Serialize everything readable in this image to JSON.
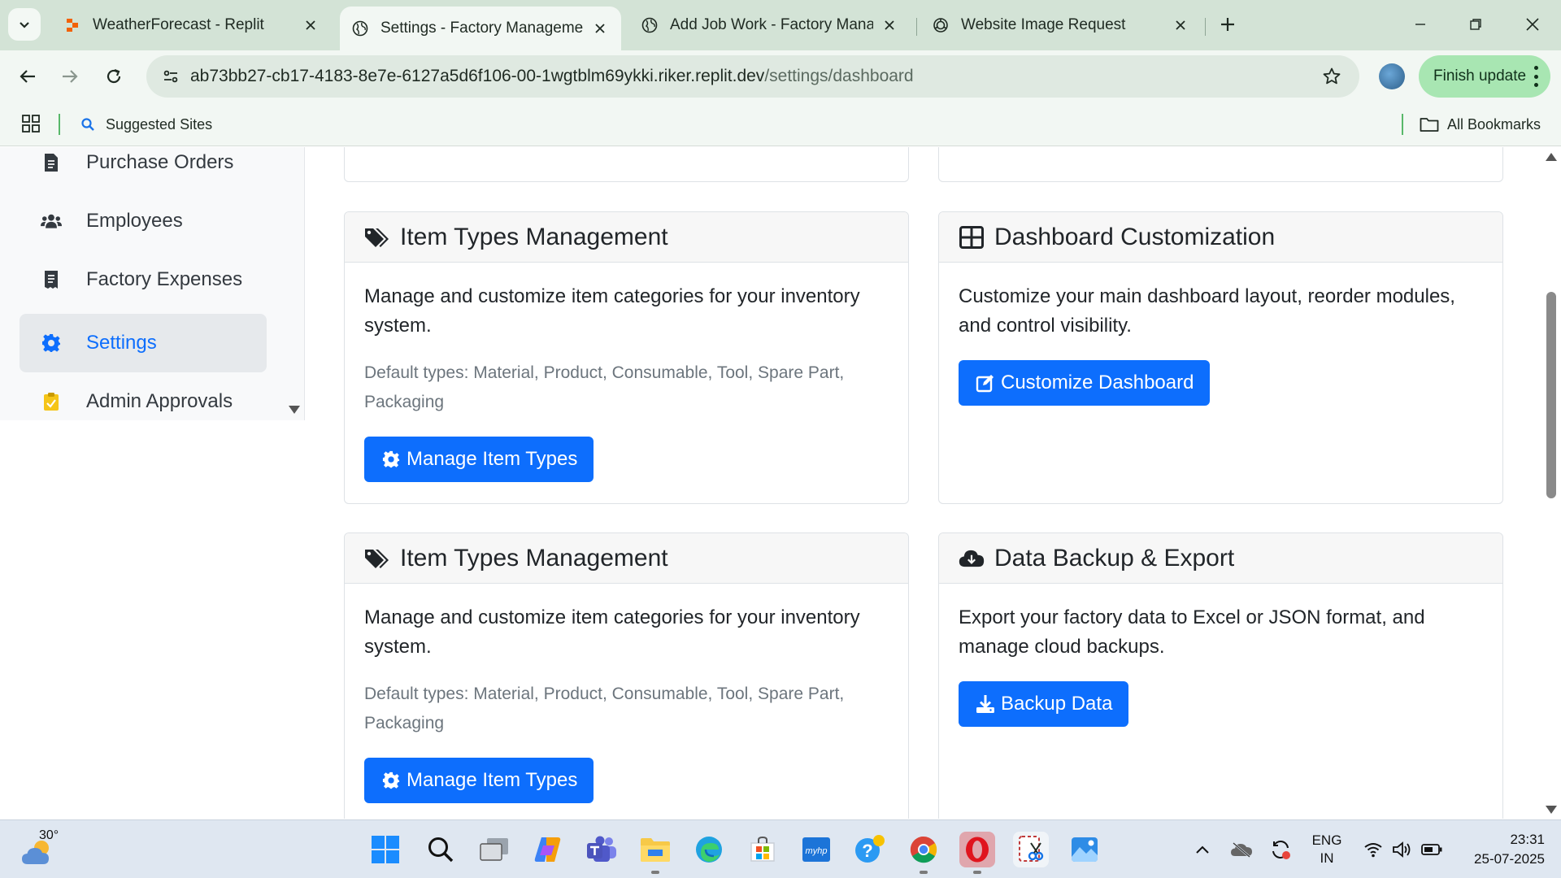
{
  "browser": {
    "tabs": [
      {
        "title": "WeatherForecast - Replit",
        "active": false
      },
      {
        "title": "Settings - Factory Management",
        "active": true
      },
      {
        "title": "Add Job Work - Factory Management",
        "active": false
      },
      {
        "title": "Website Image Request",
        "active": false
      }
    ],
    "url": {
      "host": "ab73bb27-cb17-4183-8e7e-6127a5d6f106-00-1wgtblm69ykki.riker.replit.dev",
      "path": "/settings/dashboard"
    },
    "finish_update_label": "Finish update",
    "bookmarks": {
      "suggested_sites": "Suggested Sites",
      "all_bookmarks": "All Bookmarks"
    }
  },
  "sidebar": {
    "items": [
      {
        "label": "Purchase Orders",
        "icon": "document-icon",
        "active": false
      },
      {
        "label": "Employees",
        "icon": "users-icon",
        "active": false
      },
      {
        "label": "Factory Expenses",
        "icon": "receipt-icon",
        "active": false
      },
      {
        "label": "Settings",
        "icon": "gear-icon",
        "active": true
      },
      {
        "label": "Admin Approvals",
        "icon": "clipboard-check-icon",
        "active": false
      }
    ]
  },
  "cards": {
    "item_types_1": {
      "title": "Item Types Management",
      "description": "Manage and customize item categories for your inventory system.",
      "defaults": "Default types: Material, Product, Consumable, Tool, Spare Part, Packaging",
      "button": "Manage Item Types"
    },
    "dashboard": {
      "title": "Dashboard Customization",
      "description": "Customize your main dashboard layout, reorder modules, and control visibility.",
      "button": "Customize Dashboard"
    },
    "item_types_2": {
      "title": "Item Types Management",
      "description": "Manage and customize item categories for your inventory system.",
      "defaults": "Default types: Material, Product, Consumable, Tool, Spare Part, Packaging",
      "button": "Manage Item Types"
    },
    "backup": {
      "title": "Data Backup & Export",
      "description": "Export your factory data to Excel or JSON format, and manage cloud backups.",
      "button": "Backup Data"
    }
  },
  "taskbar": {
    "weather_temp": "30°",
    "language_line1": "ENG",
    "language_line2": "IN",
    "time": "23:31",
    "date": "25-07-2025"
  },
  "colors": {
    "primary": "#0d6efd",
    "chrome_frame": "#d3e3d6",
    "finish_update": "#a8e6b2"
  }
}
